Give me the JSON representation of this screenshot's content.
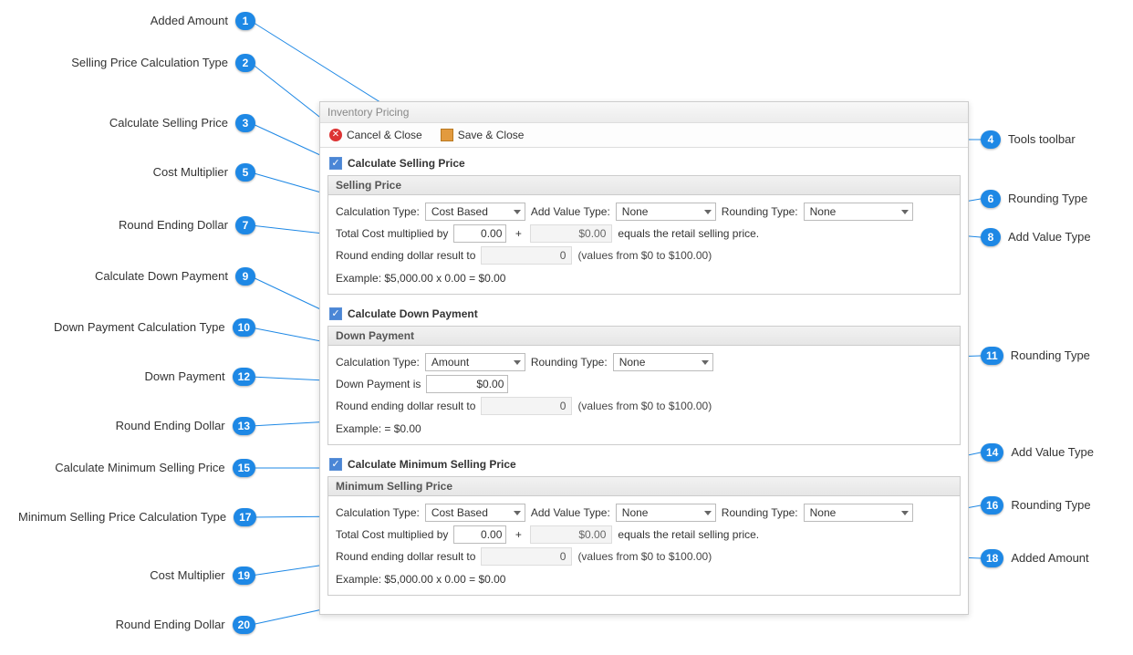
{
  "window": {
    "title": "Inventory Pricing"
  },
  "toolbar": {
    "cancel": "Cancel & Close",
    "save": "Save & Close"
  },
  "sp": {
    "calc_label": "Calculate Selling Price",
    "header": "Selling Price",
    "calc_type_lbl": "Calculation Type:",
    "calc_type_val": "Cost Based",
    "add_val_lbl": "Add Value Type:",
    "add_val_val": "None",
    "round_type_lbl": "Rounding Type:",
    "round_type_val": "None",
    "mult_lbl": "Total Cost multiplied by",
    "mult_val": "0.00",
    "plus": "+",
    "added_amt": "$0.00",
    "mult_tail": "equals the retail selling price.",
    "round_lbl": "Round ending dollar result to",
    "round_val": "0",
    "round_hint": "(values from $0 to $100.00)",
    "example": "Example:  $5,000.00 x 0.00  = $0.00"
  },
  "dp": {
    "calc_label": "Calculate Down Payment",
    "header": "Down Payment",
    "calc_type_lbl": "Calculation Type:",
    "calc_type_val": "Amount",
    "round_type_lbl": "Rounding Type:",
    "round_type_val": "None",
    "amt_lbl": "Down Payment is",
    "amt_val": "$0.00",
    "round_lbl": "Round ending dollar result to",
    "round_val": "0",
    "round_hint": "(values from $0 to $100.00)",
    "example": "Example:   = $0.00"
  },
  "msp": {
    "calc_label": "Calculate Minimum Selling Price",
    "header": "Minimum Selling Price",
    "calc_type_lbl": "Calculation Type:",
    "calc_type_val": "Cost Based",
    "add_val_lbl": "Add Value Type:",
    "add_val_val": "None",
    "round_type_lbl": "Rounding Type:",
    "round_type_val": "None",
    "mult_lbl": "Total Cost multiplied by",
    "mult_val": "0.00",
    "plus": "+",
    "added_amt": "$0.00",
    "mult_tail": "equals the retail selling price.",
    "round_lbl": "Round ending dollar result to",
    "round_val": "0",
    "round_hint": "(values from $0 to $100.00)",
    "example": "Example:  $5,000.00 x 0.00  = $0.00"
  },
  "callouts": {
    "c1": "Added Amount",
    "c2": "Selling Price Calculation Type",
    "c3": "Calculate Selling Price",
    "c4": "Tools toolbar",
    "c5": "Cost Multiplier",
    "c6": "Rounding Type",
    "c7": "Round Ending Dollar",
    "c8": "Add Value Type",
    "c9": "Calculate Down Payment",
    "c10": "Down Payment Calculation Type",
    "c11": "Rounding Type",
    "c12": "Down Payment",
    "c13": "Round Ending Dollar",
    "c14": "Add Value Type",
    "c15": "Calculate Minimum Selling Price",
    "c16": "Rounding Type",
    "c17": "Minimum Selling Price Calculation Type",
    "c18": "Added Amount",
    "c19": "Cost Multiplier",
    "c20": "Round Ending Dollar"
  }
}
